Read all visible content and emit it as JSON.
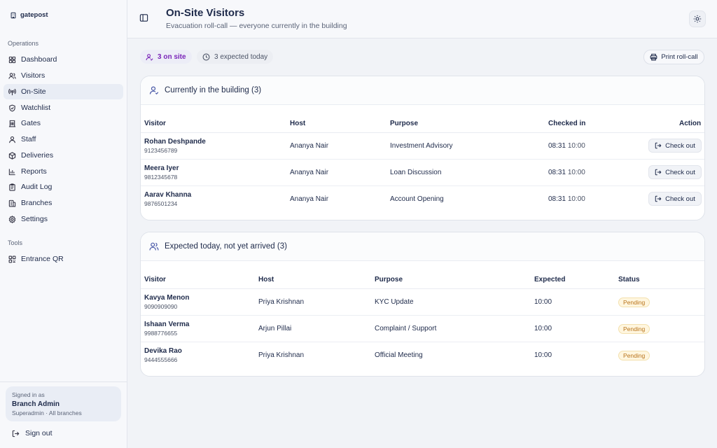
{
  "brand": {
    "name": "gatepost",
    "icon": "building-icon"
  },
  "sidebar": {
    "section_operations": "Operations",
    "items": [
      {
        "label": "Dashboard",
        "icon": "grid-icon"
      },
      {
        "label": "Visitors",
        "icon": "users-icon"
      },
      {
        "label": "On-Site",
        "icon": "radio-icon",
        "active": true
      },
      {
        "label": "Watchlist",
        "icon": "shield-icon"
      },
      {
        "label": "Gates",
        "icon": "door-icon"
      },
      {
        "label": "Staff",
        "icon": "user-icon"
      },
      {
        "label": "Deliveries",
        "icon": "package-icon"
      },
      {
        "label": "Reports",
        "icon": "bar-chart-icon"
      },
      {
        "label": "Audit Log",
        "icon": "clipboard-icon"
      },
      {
        "label": "Branches",
        "icon": "building-icon"
      },
      {
        "label": "Settings",
        "icon": "gear-icon"
      }
    ],
    "section_tools": "Tools",
    "tools": [
      {
        "label": "Entrance QR",
        "icon": "qr-icon"
      }
    ],
    "signed_in_as": "Signed in as",
    "user_name": "Branch Admin",
    "user_role": "Superadmin · All branches",
    "sign_out": "Sign out"
  },
  "header": {
    "title": "On-Site Visitors",
    "subtitle": "Evacuation roll-call — everyone currently in the building"
  },
  "stats": {
    "on_site": "3 on site",
    "expected": "3 expected today",
    "print_label": "Print roll-call"
  },
  "onsite_table": {
    "title": "Currently in the building (3)",
    "columns": [
      "Visitor",
      "Host",
      "Purpose",
      "Checked in",
      "Action"
    ],
    "rows": [
      {
        "name": "Rohan Deshpande",
        "phone": "9123456789",
        "host": "Ananya Nair",
        "purpose": "Investment Advisory",
        "checkin_time": "08:31",
        "checkin_expected": "10:00",
        "action": "Check out"
      },
      {
        "name": "Meera Iyer",
        "phone": "9812345678",
        "host": "Ananya Nair",
        "purpose": "Loan Discussion",
        "checkin_time": "08:31",
        "checkin_expected": "10:00",
        "action": "Check out"
      },
      {
        "name": "Aarav Khanna",
        "phone": "9876501234",
        "host": "Ananya Nair",
        "purpose": "Account Opening",
        "checkin_time": "08:31",
        "checkin_expected": "10:00",
        "action": "Check out"
      }
    ]
  },
  "expected_table": {
    "title": "Expected today, not yet arrived (3)",
    "columns": [
      "Visitor",
      "Host",
      "Purpose",
      "Expected",
      "Status"
    ],
    "rows": [
      {
        "name": "Kavya Menon",
        "phone": "9090909090",
        "host": "Priya Krishnan",
        "purpose": "KYC Update",
        "expected": "10:00",
        "status": "Pending"
      },
      {
        "name": "Ishaan Verma",
        "phone": "9988776655",
        "host": "Arjun Pillai",
        "purpose": "Complaint / Support",
        "expected": "10:00",
        "status": "Pending"
      },
      {
        "name": "Devika Rao",
        "phone": "9444555666",
        "host": "Priya Krishnan",
        "purpose": "Official Meeting",
        "expected": "10:00",
        "status": "Pending"
      }
    ]
  }
}
